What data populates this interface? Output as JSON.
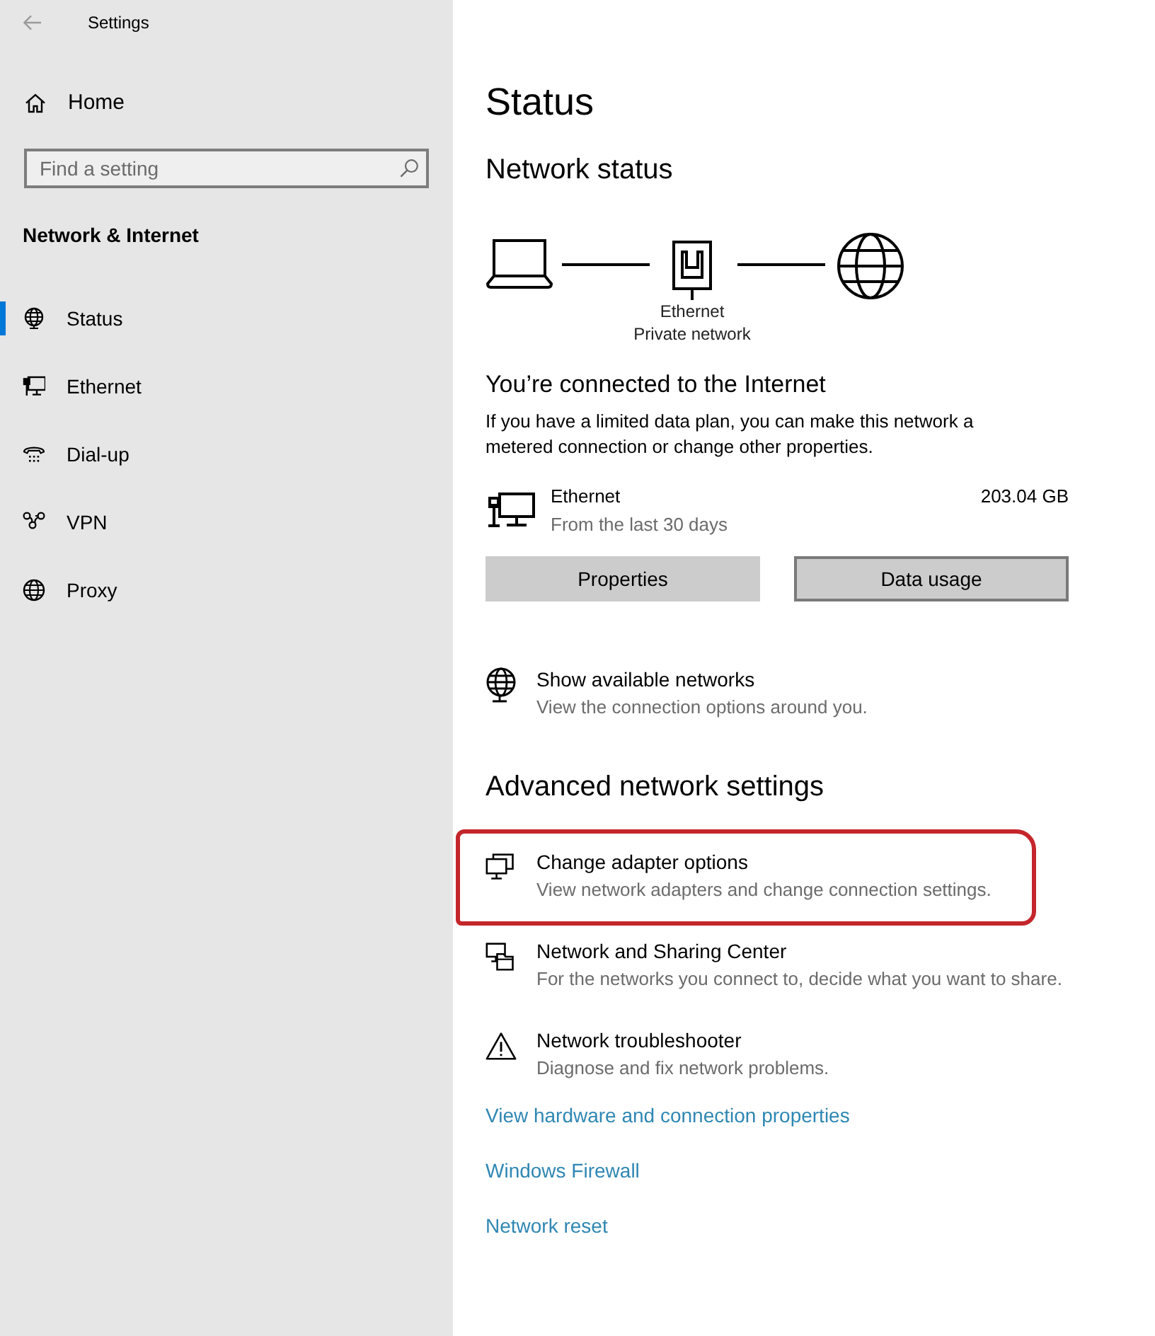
{
  "window": {
    "title": "Settings"
  },
  "sidebar": {
    "home": "Home",
    "search": {
      "placeholder": "Find a setting"
    },
    "section_title": "Network & Internet",
    "items": [
      {
        "label": "Status",
        "selected": true
      },
      {
        "label": "Ethernet",
        "selected": false
      },
      {
        "label": "Dial-up",
        "selected": false
      },
      {
        "label": "VPN",
        "selected": false
      },
      {
        "label": "Proxy",
        "selected": false
      }
    ]
  },
  "main": {
    "title": "Status",
    "network_status": {
      "heading": "Network status",
      "diagram": {
        "adapter": "Ethernet",
        "profile": "Private network"
      },
      "connection_heading": "You’re connected to the Internet",
      "description": "If you have a limited data plan, you can make this network a metered connection or change other properties.",
      "adapter": {
        "name": "Ethernet",
        "period": "From the last 30 days",
        "usage": "203.04 GB"
      },
      "buttons": [
        {
          "label": "Properties",
          "focused": false
        },
        {
          "label": "Data usage",
          "focused": true
        }
      ],
      "show_networks": {
        "title": "Show available networks",
        "description": "View the connection options around you."
      }
    },
    "advanced": {
      "heading": "Advanced network settings",
      "items": [
        {
          "title": "Change adapter options",
          "description": "View network adapters and change connection settings.",
          "highlighted": true
        },
        {
          "title": "Network and Sharing Center",
          "description": "For the networks you connect to, decide what you want to share.",
          "highlighted": false
        },
        {
          "title": "Network troubleshooter",
          "description": "Diagnose and fix network problems.",
          "highlighted": false
        }
      ],
      "links": [
        "View hardware and connection properties",
        "Windows Firewall",
        "Network reset"
      ]
    }
  }
}
